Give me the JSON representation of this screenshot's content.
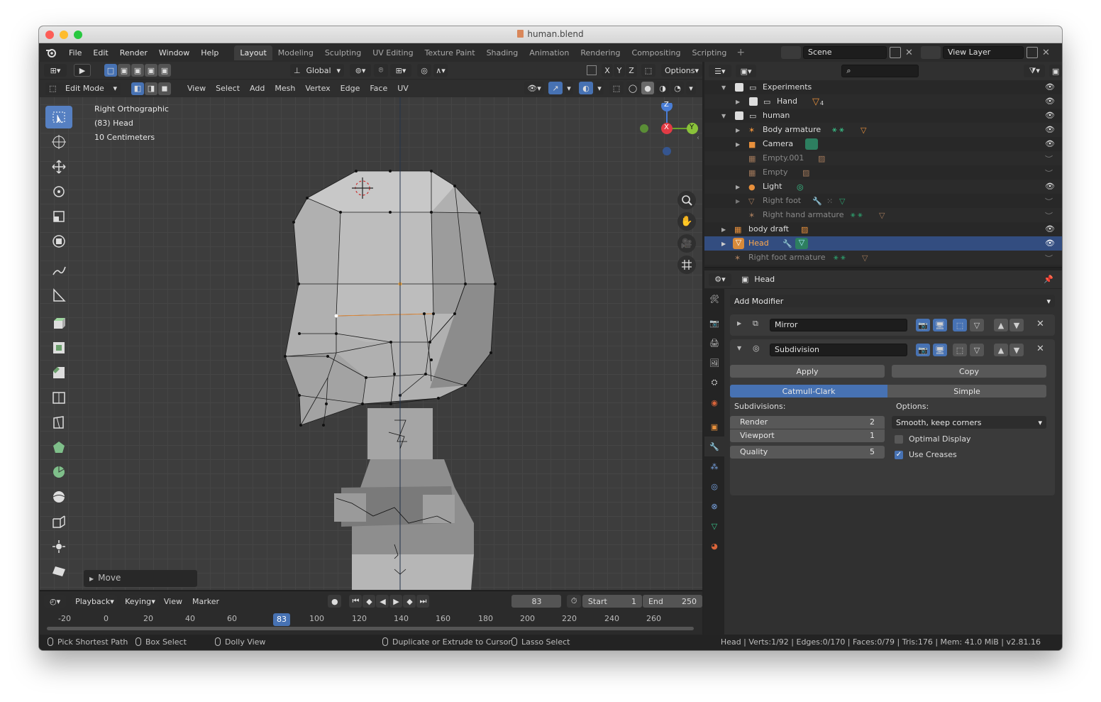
{
  "window": {
    "title": "human.blend"
  },
  "menu": [
    "File",
    "Edit",
    "Render",
    "Window",
    "Help"
  ],
  "workspaces": [
    "Layout",
    "Modeling",
    "Sculpting",
    "UV Editing",
    "Texture Paint",
    "Shading",
    "Animation",
    "Rendering",
    "Compositing",
    "Scripting"
  ],
  "scene": {
    "name": "Scene",
    "view_layer": "View Layer"
  },
  "viewport": {
    "transform_orientation": "Global",
    "options_label": "Options",
    "axes": [
      "X",
      "Y",
      "Z"
    ],
    "mode": "Edit Mode",
    "menus": [
      "View",
      "Select",
      "Add",
      "Mesh",
      "Vertex",
      "Edge",
      "Face",
      "UV"
    ],
    "info": [
      "Right Orthographic",
      "(83) Head",
      "10 Centimeters"
    ],
    "gizmo": {
      "z": "Z",
      "y": "Y",
      "x": "X"
    },
    "last_operator": "Move"
  },
  "timeline": {
    "menus": [
      "Playback",
      "Keying",
      "View",
      "Marker"
    ],
    "current_frame": "83",
    "start_label": "Start",
    "start": "1",
    "end_label": "End",
    "end": "250",
    "ruler": [
      "-20",
      "0",
      "20",
      "40",
      "60",
      "100",
      "120",
      "140",
      "160",
      "180",
      "200",
      "220",
      "240",
      "260"
    ]
  },
  "outliner": {
    "rows": [
      {
        "label": "Experiments",
        "kind": "collection"
      },
      {
        "label": "Hand",
        "kind": "collection",
        "badge": "4"
      },
      {
        "label": "human",
        "kind": "collection"
      },
      {
        "label": "Body armature",
        "kind": "armature"
      },
      {
        "label": "Camera",
        "kind": "camera"
      },
      {
        "label": "Empty.001",
        "kind": "empty"
      },
      {
        "label": "Empty",
        "kind": "empty"
      },
      {
        "label": "Light",
        "kind": "light"
      },
      {
        "label": "Right foot",
        "kind": "mesh"
      },
      {
        "label": "Right hand armature",
        "kind": "armature"
      },
      {
        "label": "body draft",
        "kind": "image"
      },
      {
        "label": "Head",
        "kind": "mesh"
      },
      {
        "label": "Right foot armature",
        "kind": "armature"
      }
    ]
  },
  "properties": {
    "object_name": "Head",
    "add_modifier": "Add Modifier",
    "mirror_name": "Mirror",
    "subdivision_name": "Subdivision",
    "apply": "Apply",
    "copy": "Copy",
    "catmull": "Catmull-Clark",
    "simple": "Simple",
    "subdivisions_label": "Subdivisions:",
    "options_label": "Options:",
    "render_label": "Render",
    "render_val": "2",
    "viewport_label": "Viewport",
    "viewport_val": "1",
    "quality_label": "Quality",
    "quality_val": "5",
    "uv_smooth": "Smooth, keep corners",
    "optimal_display": "Optimal Display",
    "use_creases": "Use Creases"
  },
  "statusbar": {
    "hints": [
      "Pick Shortest Path",
      "Box Select",
      "Dolly View",
      "Duplicate or Extrude to Cursor",
      "Lasso Select"
    ],
    "stats": "Head | Verts:1/92 | Edges:0/170 | Faces:0/79 | Tris:176 | Mem: 41.0 MiB | v2.81.16"
  },
  "colors": {
    "accent": "#4772b3",
    "selected_row": "#334d80",
    "object_orange": "#e8903c",
    "armature_green": "#39c48a"
  }
}
